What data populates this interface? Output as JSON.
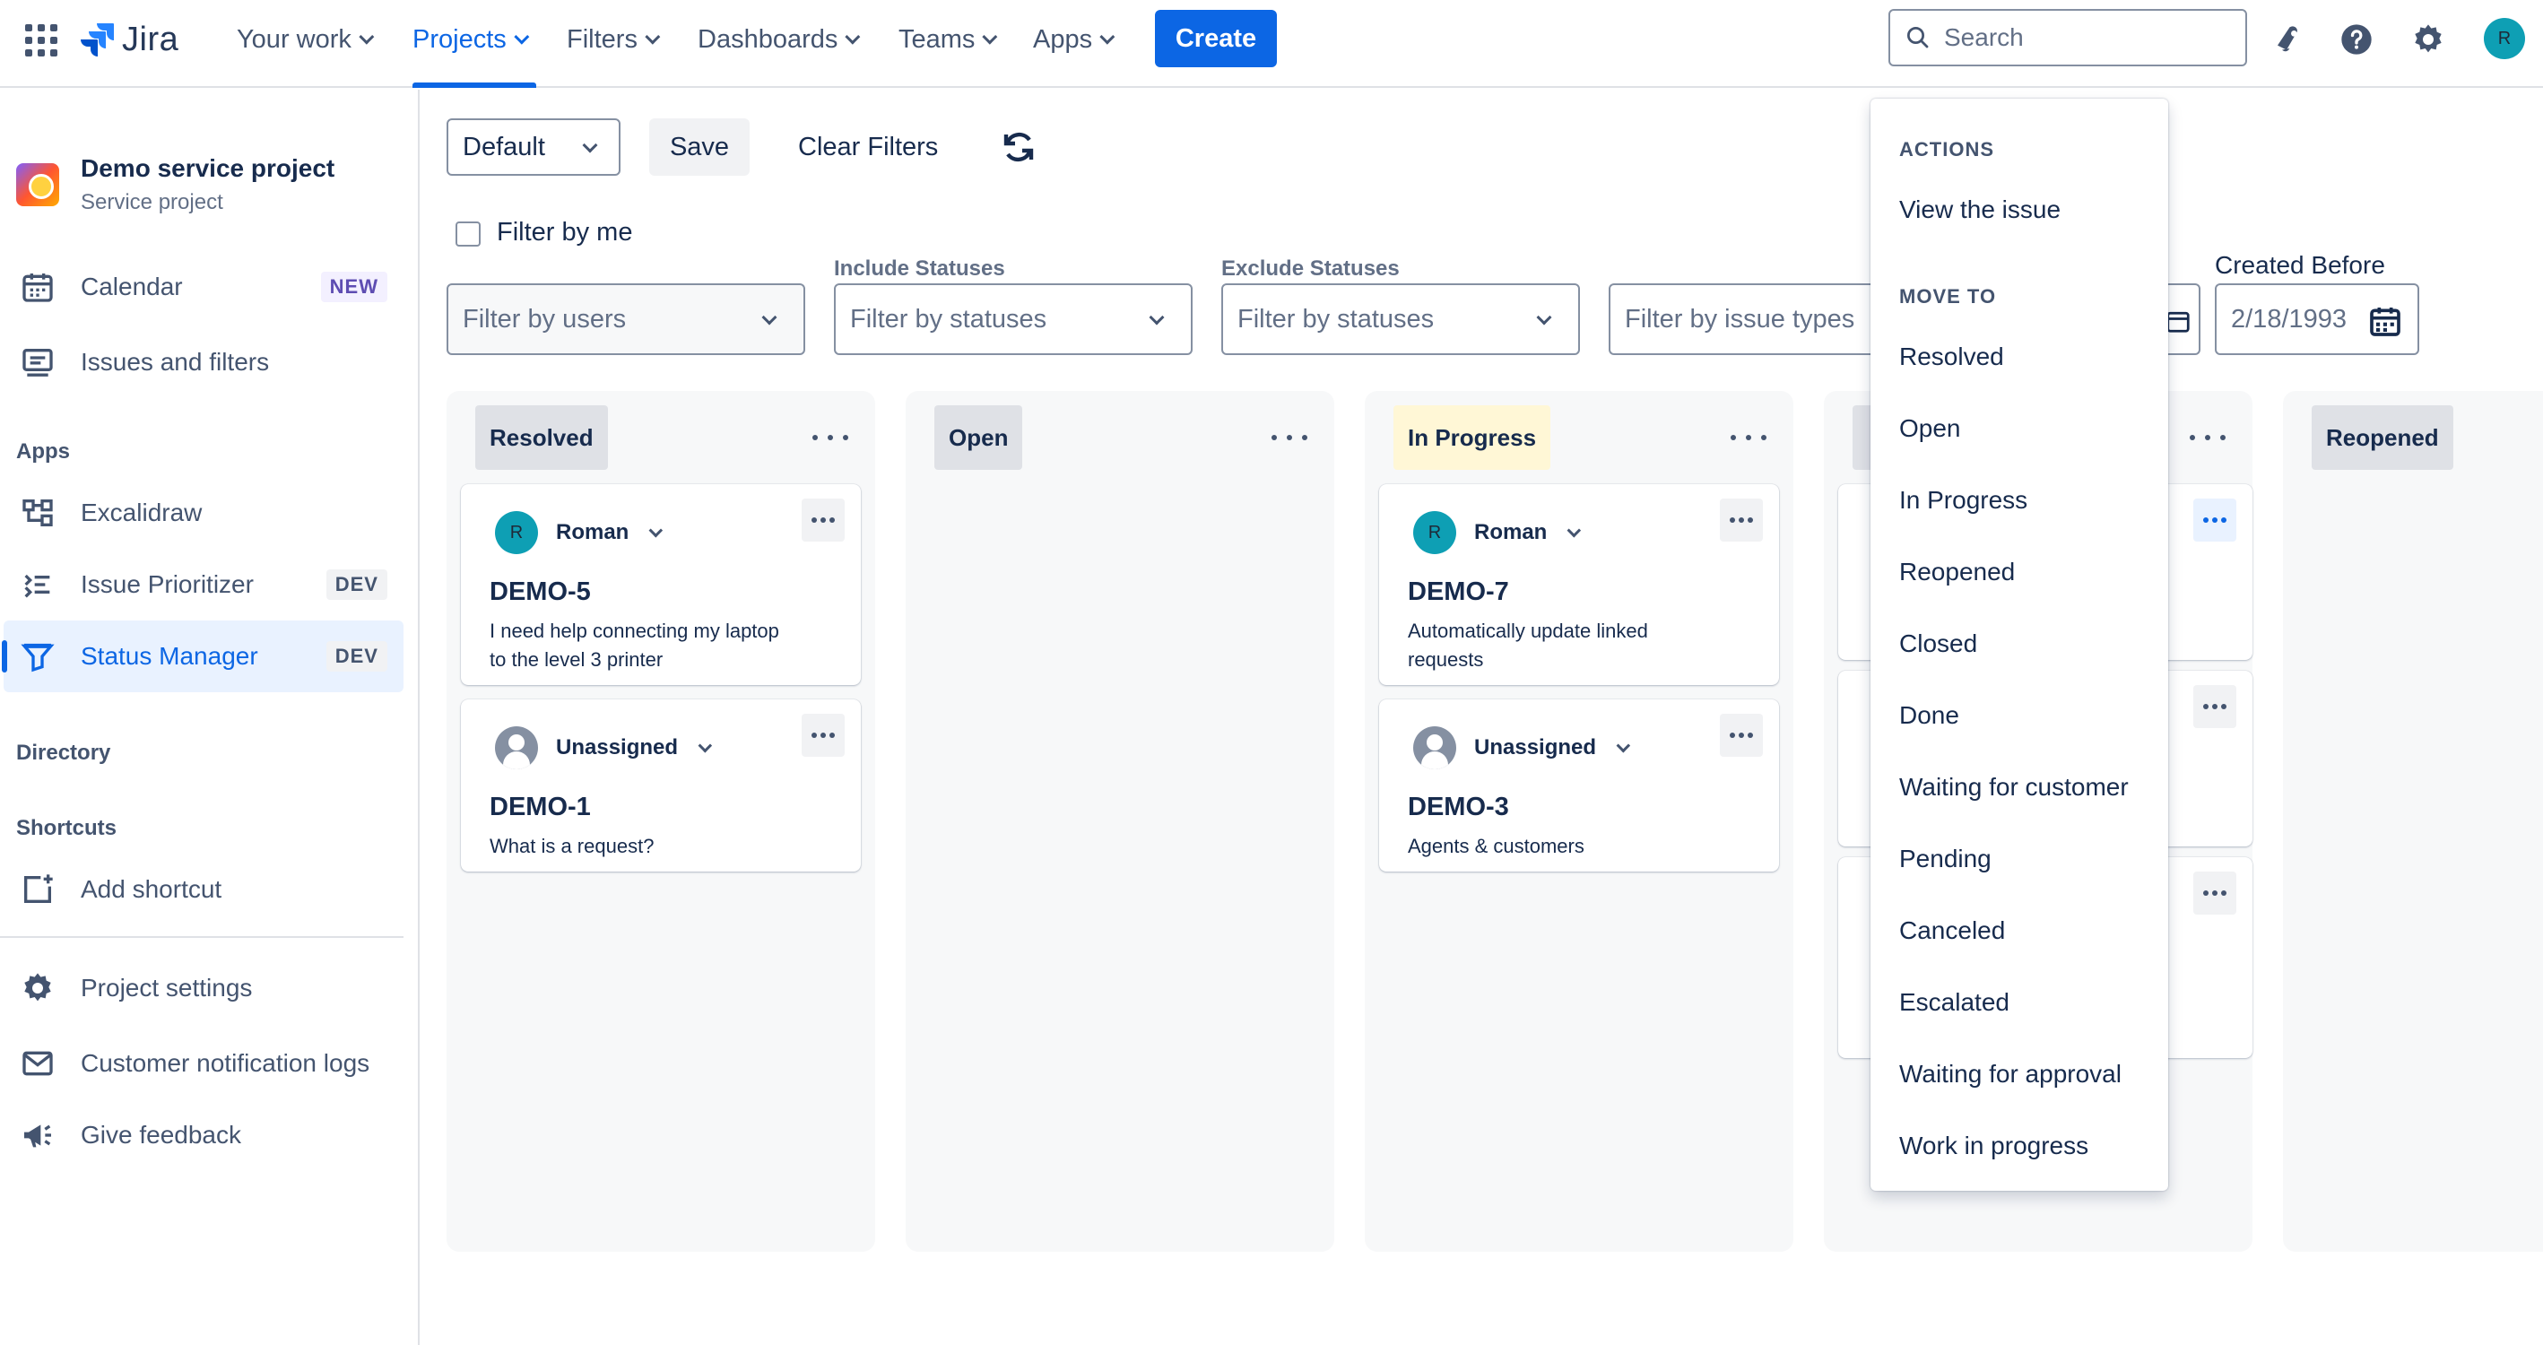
{
  "topnav": {
    "logo_text": "Jira",
    "items": [
      {
        "label": "Your work"
      },
      {
        "label": "Projects"
      },
      {
        "label": "Filters"
      },
      {
        "label": "Dashboards"
      },
      {
        "label": "Teams"
      },
      {
        "label": "Apps"
      }
    ],
    "active_item": "Projects",
    "create_label": "Create",
    "search_placeholder": "Search",
    "avatar_initial": "R",
    "icons": [
      "notifications-icon",
      "help-icon",
      "settings-icon"
    ]
  },
  "sidebar": {
    "project_title": "Demo service project",
    "project_subtitle": "Service project",
    "items": [
      {
        "label": "Calendar",
        "badge": "NEW",
        "icon": "calendar-icon"
      },
      {
        "label": "Issues and filters",
        "icon": "issues-icon"
      }
    ],
    "apps_heading": "Apps",
    "apps": [
      {
        "label": "Excalidraw",
        "icon": "excalidraw-icon"
      },
      {
        "label": "Issue Prioritizer",
        "badge": "DEV",
        "icon": "prioritizer-icon"
      },
      {
        "label": "Status Manager",
        "badge": "DEV",
        "icon": "status-manager-icon",
        "selected": true
      }
    ],
    "directory_heading": "Directory",
    "shortcuts_heading": "Shortcuts",
    "add_shortcut": "Add shortcut",
    "footer": [
      {
        "label": "Project settings",
        "icon": "gear-icon"
      },
      {
        "label": "Customer notification logs",
        "icon": "mail-icon"
      },
      {
        "label": "Give feedback",
        "icon": "megaphone-icon"
      }
    ]
  },
  "filters": {
    "view_select": "Default",
    "save_label": "Save",
    "clear_label": "Clear Filters",
    "filter_by_me": "Filter by me",
    "users_placeholder": "Filter by users",
    "include_label": "Include Statuses",
    "include_placeholder": "Filter by statuses",
    "exclude_label": "Exclude Statuses",
    "exclude_placeholder": "Filter by statuses",
    "types_placeholder": "Filter by issue types",
    "created_before_label": "Created Before",
    "created_before_value": "2/18/1993"
  },
  "board": {
    "columns": [
      {
        "status": "Resolved"
      },
      {
        "status": "Open"
      },
      {
        "status": "In Progress"
      },
      {
        "status": ""
      },
      {
        "status": "Reopened"
      }
    ],
    "cards": {
      "demo5": {
        "assignee": "Roman",
        "initial": "R",
        "key": "DEMO-5",
        "summary": "I need help connecting my laptop to the level 3 printer"
      },
      "demo1": {
        "assignee": "Unassigned",
        "key": "DEMO-1",
        "summary": "What is a request?"
      },
      "demo7": {
        "assignee": "Roman",
        "initial": "R",
        "key": "DEMO-7",
        "summary": "Automatically update linked requests"
      },
      "demo3": {
        "assignee": "Unassigned",
        "key": "DEMO-3",
        "summary": "Agents & customers"
      }
    }
  },
  "dropdown": {
    "actions_heading": "ACTIONS",
    "view_issue": "View the issue",
    "move_to_heading": "MOVE TO",
    "move_to": [
      "Resolved",
      "Open",
      "In Progress",
      "Reopened",
      "Closed",
      "Done",
      "Waiting for customer",
      "Pending",
      "Canceled",
      "Escalated",
      "Waiting for approval",
      "Work in progress"
    ]
  },
  "colors": {
    "accent": "#0c66e4",
    "avatar": "#0e9fb4",
    "in_progress_lozenge": "#fff7d6"
  }
}
